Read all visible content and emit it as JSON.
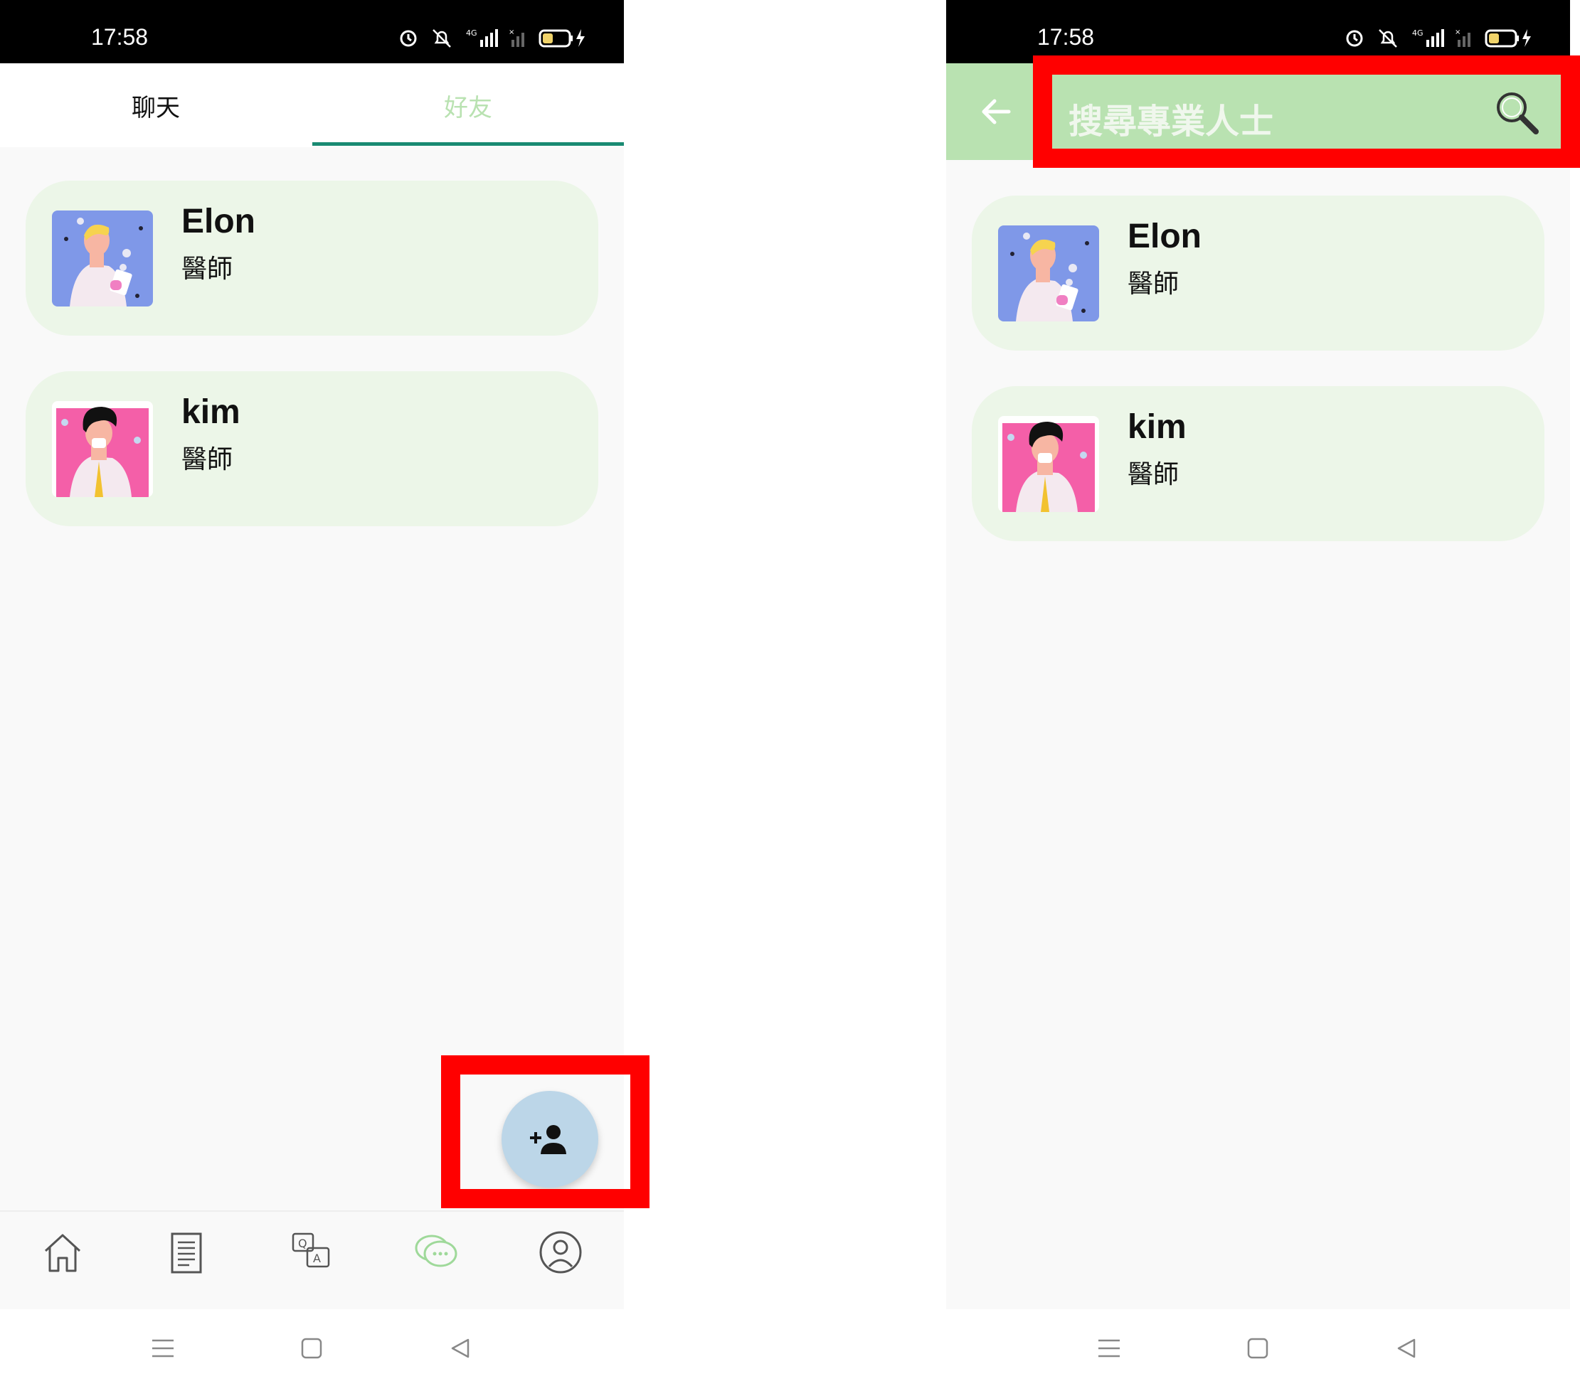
{
  "left_screen": {
    "status_time": "17:58",
    "tabs": [
      {
        "label": "聊天"
      },
      {
        "label": "好友"
      }
    ],
    "friends": [
      {
        "name": "Elon",
        "role": "醫師"
      },
      {
        "name": "kim",
        "role": "醫師"
      }
    ],
    "fab_icon": "person-add-icon",
    "bottom_nav": [
      "home-icon",
      "document-icon",
      "qa-icon",
      "chat-bubbles-icon",
      "profile-icon"
    ]
  },
  "right_screen": {
    "status_time": "17:58",
    "search_placeholder": "搜尋專業人士",
    "friends": [
      {
        "name": "Elon",
        "role": "醫師"
      },
      {
        "name": "kim",
        "role": "醫師"
      }
    ]
  },
  "colors": {
    "accent_green": "#b9e2b1",
    "tab_underline": "#1a8a72",
    "card_bg": "#ecf6e8",
    "fab_bg": "#bcd6e8",
    "highlight": "#ff0000"
  }
}
